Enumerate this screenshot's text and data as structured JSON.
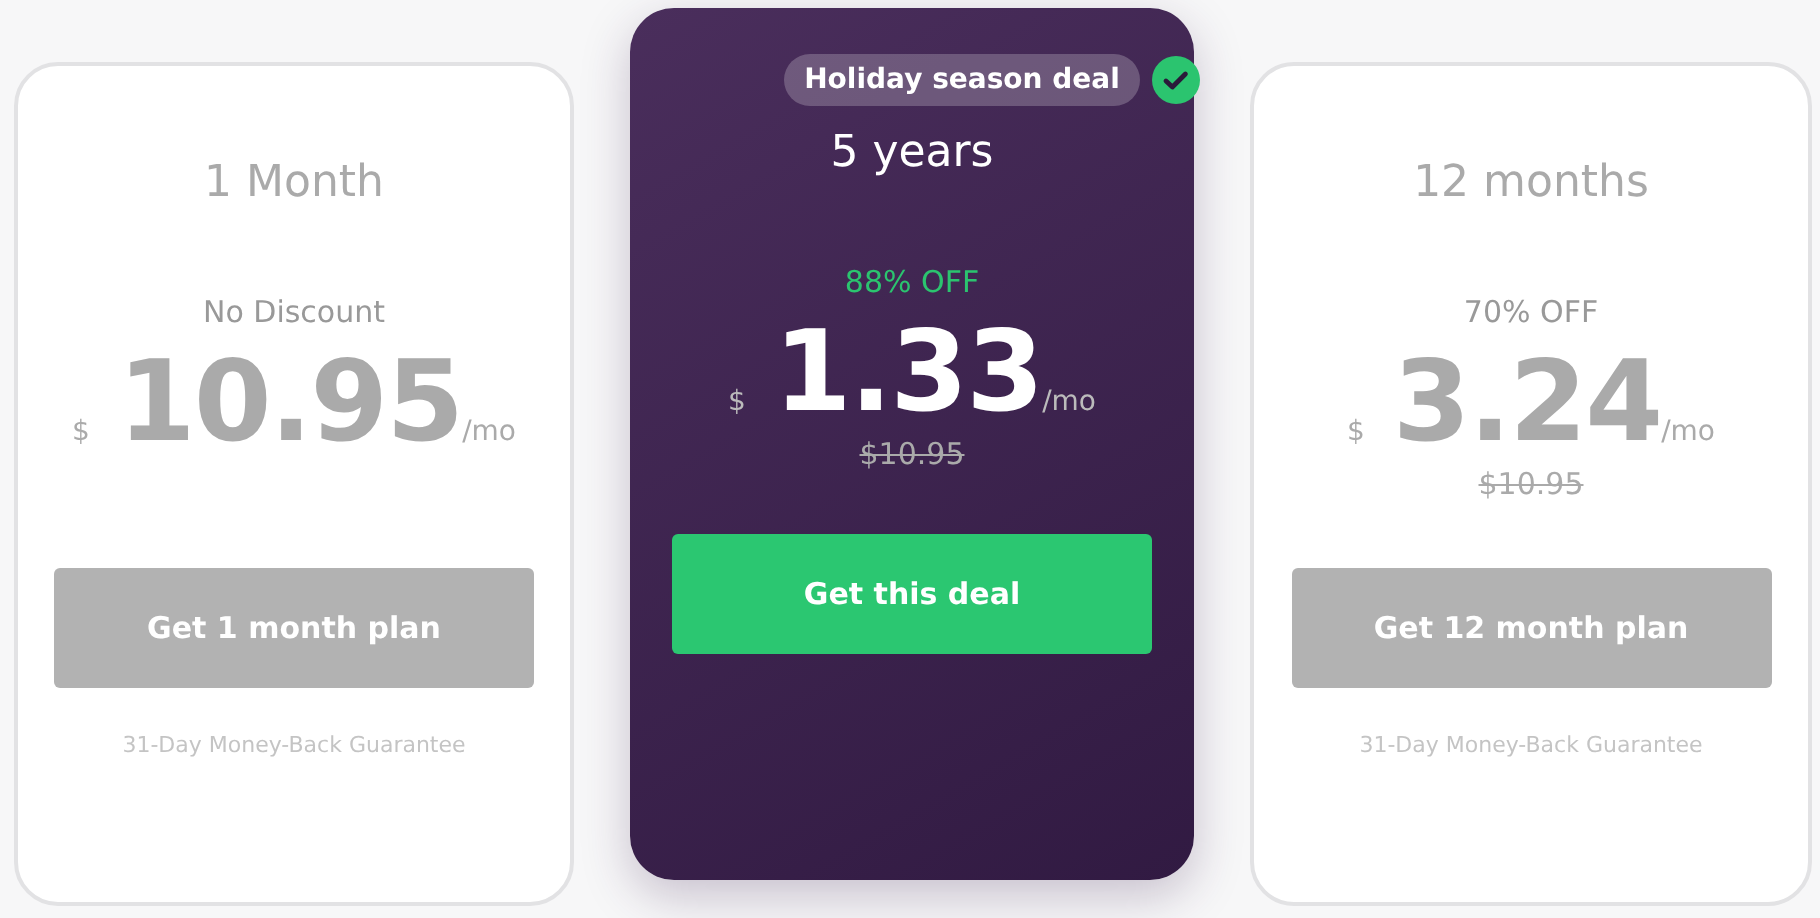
{
  "plans": [
    {
      "title": "1 Month",
      "selected": false,
      "discount": "No Discount",
      "currency": "$",
      "price": "10.95",
      "unit": "/mo",
      "button": "Get 1 month plan",
      "guarantee": "31-Day Money-Back Guarantee"
    },
    {
      "title": "5 years",
      "selected": true,
      "badge": "Holiday season deal",
      "discount": "88% OFF",
      "currency": "$",
      "price": "1.33",
      "unit": "/mo",
      "old_price": "$10.95",
      "button": "Get this deal"
    },
    {
      "title": "12 months",
      "selected": false,
      "discount": "70% OFF",
      "currency": "$",
      "price": "3.24",
      "unit": "/mo",
      "old_price": "$10.95",
      "button": "Get 12 month plan",
      "guarantee": "31-Day Money-Back Guarantee"
    }
  ]
}
